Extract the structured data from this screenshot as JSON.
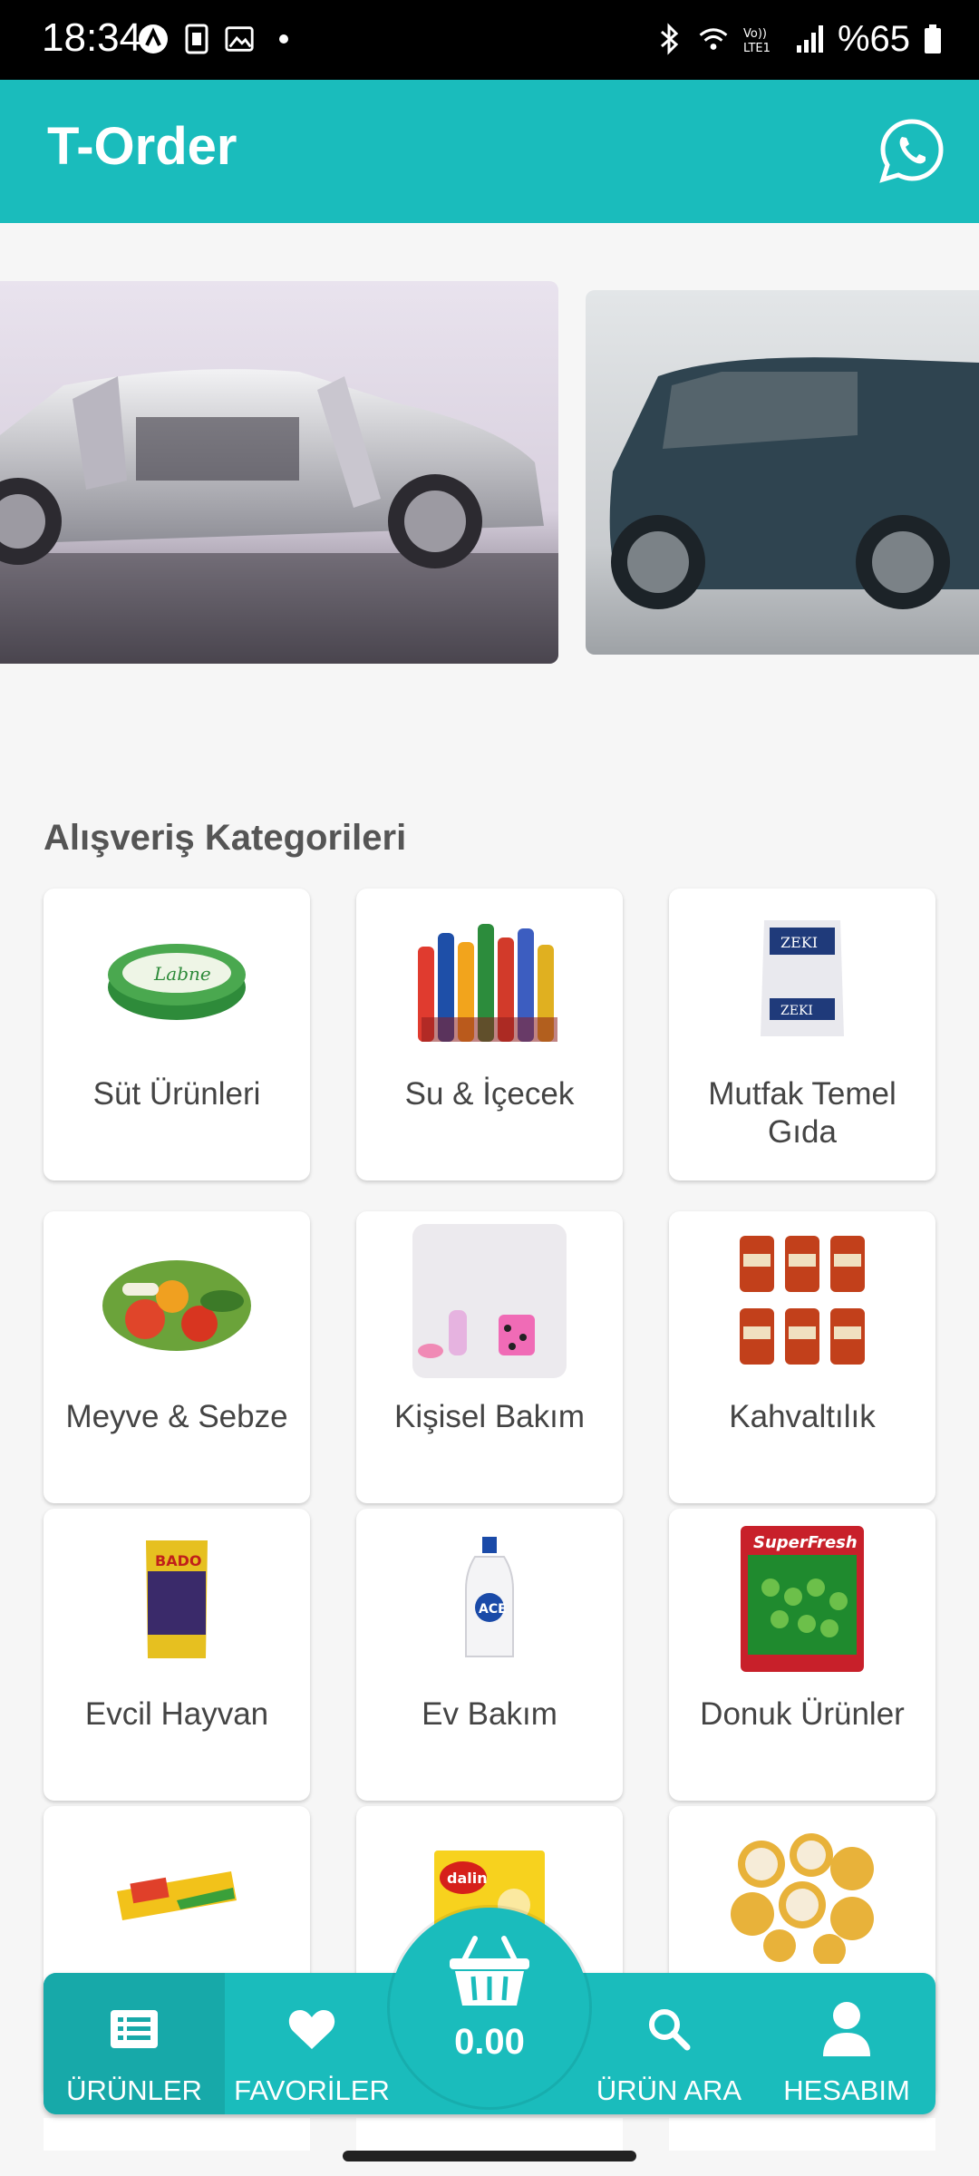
{
  "status_bar": {
    "time": "18:34",
    "battery_text": "%65",
    "network_label": "Vo)) LTE1"
  },
  "app": {
    "title": "T-Order",
    "whatsapp_icon": "whatsapp-icon"
  },
  "banners": [
    {
      "name": "car-interior-banner"
    },
    {
      "name": "suv-banner"
    }
  ],
  "categories_section": {
    "title": "Alışveriş Kategorileri",
    "items": [
      {
        "label": "Süt Ürünleri"
      },
      {
        "label": "Su & İçecek"
      },
      {
        "label": "Mutfak Temel Gıda"
      },
      {
        "label": "Meyve & Sebze"
      },
      {
        "label": "Kişisel Bakım"
      },
      {
        "label": "Kahvaltılık"
      },
      {
        "label": "Evcil Hayvan"
      },
      {
        "label": "Ev Bakım"
      },
      {
        "label": "Donuk Ürünler"
      },
      {
        "label": ""
      },
      {
        "label": ""
      },
      {
        "label": ""
      }
    ]
  },
  "bottom_nav": {
    "products": "ÜRÜNLER",
    "favorites": "FAVORİLER",
    "cart_total": "0.00",
    "search": "ÜRÜN ARA",
    "account": "HESABIM"
  },
  "colors": {
    "accent": "#1abcbc",
    "accent_active": "#17a9a9",
    "background": "#f6f6f6"
  }
}
